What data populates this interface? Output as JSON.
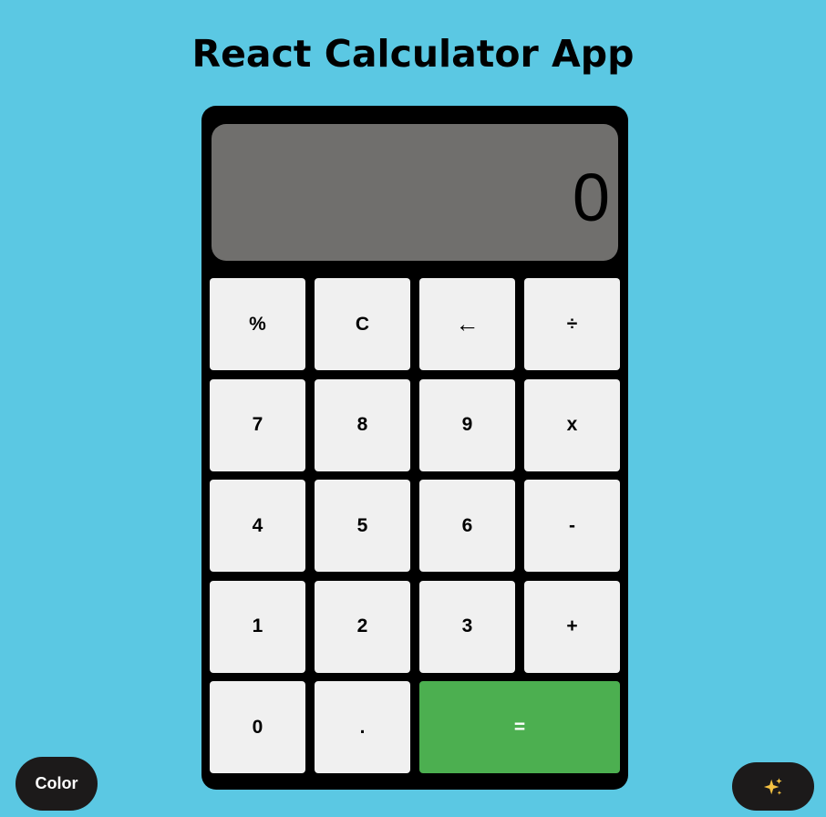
{
  "page": {
    "title": "React Calculator App"
  },
  "display": {
    "value": "0"
  },
  "keys": {
    "percent": "%",
    "clear": "C",
    "backspace": "←",
    "divide": "÷",
    "seven": "7",
    "eight": "8",
    "nine": "9",
    "multiply": "x",
    "four": "4",
    "five": "5",
    "six": "6",
    "subtract": "-",
    "one": "1",
    "two": "2",
    "three": "3",
    "add": "+",
    "zero": "0",
    "decimal": ".",
    "equals": "="
  },
  "controls": {
    "color_label": "Color",
    "magic_icon": "sparkles-icon"
  },
  "colors": {
    "background": "#5bc8e3",
    "calculator_body": "#000000",
    "display": "#706f6d",
    "key": "#f0f0f0",
    "equals_key": "#4caf50",
    "control_button": "#1c1a1a",
    "sparkle": "#f5c242"
  }
}
